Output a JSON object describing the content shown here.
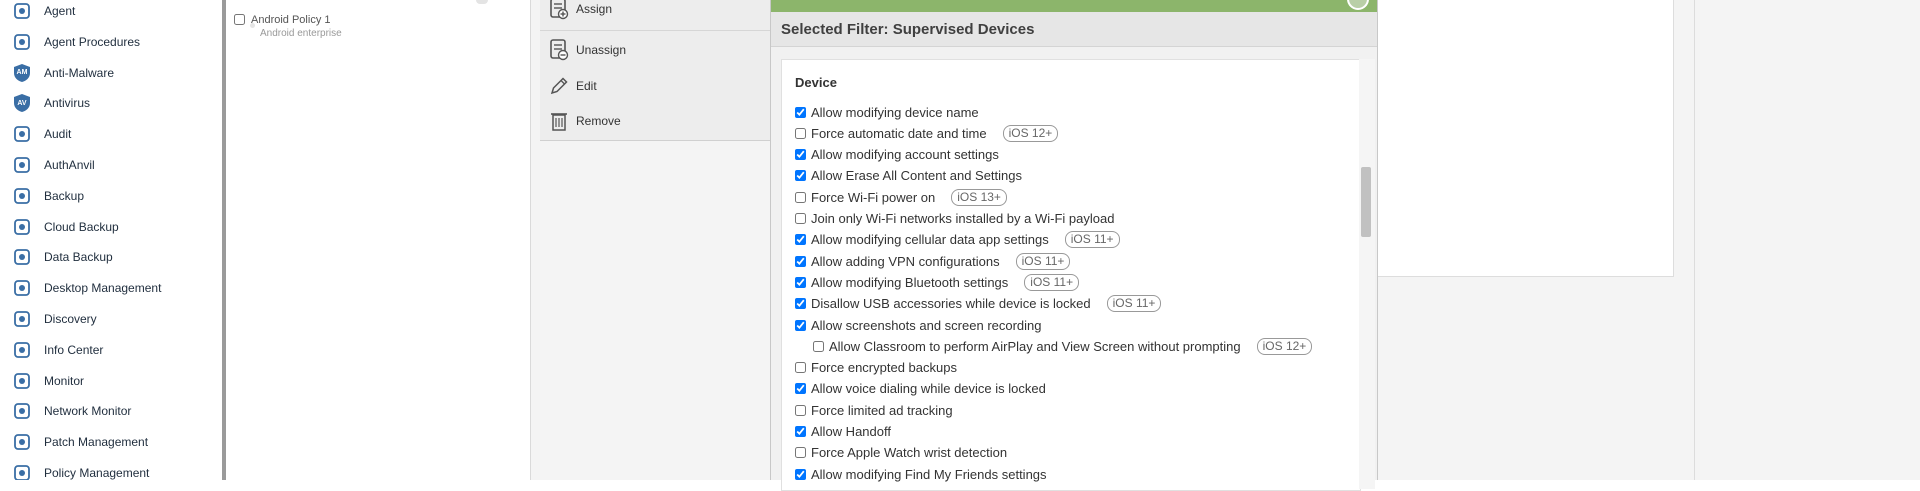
{
  "sidebar": {
    "items": [
      {
        "label": "Agent",
        "icon": "agent-icon"
      },
      {
        "label": "Agent Procedures",
        "icon": "procedures-icon"
      },
      {
        "label": "Anti-Malware",
        "icon": "anti-malware-icon",
        "badge": "AM"
      },
      {
        "label": "Antivirus",
        "icon": "antivirus-icon",
        "badge": "AV"
      },
      {
        "label": "Audit",
        "icon": "audit-icon"
      },
      {
        "label": "AuthAnvil",
        "icon": "authanvil-icon"
      },
      {
        "label": "Backup",
        "icon": "backup-icon"
      },
      {
        "label": "Cloud Backup",
        "icon": "cloud-backup-icon"
      },
      {
        "label": "Data Backup",
        "icon": "data-backup-icon"
      },
      {
        "label": "Desktop Management",
        "icon": "desktop-management-icon"
      },
      {
        "label": "Discovery",
        "icon": "discovery-icon"
      },
      {
        "label": "Info Center",
        "icon": "info-center-icon"
      },
      {
        "label": "Monitor",
        "icon": "monitor-icon"
      },
      {
        "label": "Network Monitor",
        "icon": "network-monitor-icon"
      },
      {
        "label": "Patch Management",
        "icon": "patch-management-icon"
      },
      {
        "label": "Policy Management",
        "icon": "policy-management-icon"
      }
    ],
    "icon_color": "#3a6ea5"
  },
  "tree": {
    "policy_name": "Android Policy 1",
    "policy_type": "Android enterprise"
  },
  "actions": [
    {
      "label": "Assign",
      "icon": "assign-icon"
    },
    {
      "label": "Unassign",
      "icon": "unassign-icon"
    },
    {
      "label": "Edit",
      "icon": "edit-icon"
    },
    {
      "label": "Remove",
      "icon": "remove-icon"
    }
  ],
  "modal": {
    "title": "Selected Filter: Supervised Devices",
    "accent_color": "#8cb56b",
    "section_title": "Device",
    "options": [
      {
        "label": "Allow modifying device name",
        "checked": true,
        "badge": ""
      },
      {
        "label": "Force automatic date and time",
        "checked": false,
        "badge": "iOS 12+"
      },
      {
        "label": "Allow modifying account settings",
        "checked": true,
        "badge": ""
      },
      {
        "label": "Allow Erase All Content and Settings",
        "checked": true,
        "badge": ""
      },
      {
        "label": "Force Wi-Fi power on",
        "checked": false,
        "badge": "iOS 13+"
      },
      {
        "label": "Join only Wi-Fi networks installed by a Wi-Fi payload",
        "checked": false,
        "badge": ""
      },
      {
        "label": "Allow modifying cellular data app settings",
        "checked": true,
        "badge": "iOS 11+"
      },
      {
        "label": "Allow adding VPN configurations",
        "checked": true,
        "badge": "iOS 11+"
      },
      {
        "label": "Allow modifying Bluetooth settings",
        "checked": true,
        "badge": "iOS 11+"
      },
      {
        "label": "Disallow USB accessories while device is locked",
        "checked": true,
        "badge": "iOS 11+"
      },
      {
        "label": "Allow screenshots and screen recording",
        "checked": true,
        "badge": ""
      },
      {
        "label": "Allow Classroom to perform AirPlay and View Screen without prompting",
        "checked": false,
        "badge": "iOS 12+",
        "indent": true
      },
      {
        "label": "Force encrypted backups",
        "checked": false,
        "badge": ""
      },
      {
        "label": "Allow voice dialing while device is locked",
        "checked": true,
        "badge": ""
      },
      {
        "label": "Force limited ad tracking",
        "checked": false,
        "badge": ""
      },
      {
        "label": "Allow Handoff",
        "checked": true,
        "badge": ""
      },
      {
        "label": "Force Apple Watch wrist detection",
        "checked": false,
        "badge": ""
      },
      {
        "label": "Allow modifying Find My Friends settings",
        "checked": true,
        "badge": ""
      }
    ]
  }
}
